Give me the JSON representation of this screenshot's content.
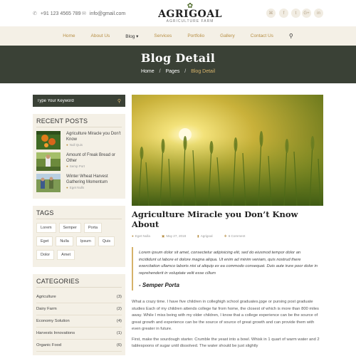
{
  "header": {
    "phone_icon": "phone-icon",
    "phone": "+91 123 4565 789",
    "email_icon": "mail-icon",
    "email": "info@gmail.com",
    "logo_name": "AGRIGOAL",
    "logo_sub": "AGRICULTURE FARM",
    "social": [
      {
        "icon": "rss-icon",
        "glyph": "⌘"
      },
      {
        "icon": "facebook-icon",
        "glyph": "f"
      },
      {
        "icon": "twitter-icon",
        "glyph": "t"
      },
      {
        "icon": "google-plus-icon",
        "glyph": "G+"
      },
      {
        "icon": "linkedin-icon",
        "glyph": "in"
      }
    ]
  },
  "nav": {
    "items": [
      "Home",
      "About Us",
      "Blog ▾",
      "Services",
      "Portfolio",
      "Gallery",
      "Contact Us"
    ],
    "active_index": 2,
    "search_icon": "search-icon"
  },
  "hero": {
    "title": "Blog Detail",
    "breadcrumb": [
      "Home",
      "Pages",
      "Blog Detail"
    ],
    "separator": "/"
  },
  "sidebar": {
    "search_placeholder": "Type Your Keyword",
    "recent_title": "RECENT POSTS",
    "recent_posts": [
      {
        "title": "Agriculture Miracle you Don't Know",
        "author": "Null Quis"
      },
      {
        "title": "Amount of Freak Bread or Other",
        "author": "Semp Port"
      },
      {
        "title": "Winter Wheat Harvest Gathering Momentum",
        "author": "Eget Nulls"
      }
    ],
    "tags_title": "TAGS",
    "tags": [
      "Lorem",
      "Semper",
      "Porta",
      "Eget",
      "Nulla",
      "Ipsum",
      "Quis",
      "Dolor",
      "Amet"
    ],
    "categories_title": "CATEGORIES",
    "categories": [
      {
        "name": "Agriculture",
        "count": "(3)"
      },
      {
        "name": "Dairy Farm",
        "count": "(2)"
      },
      {
        "name": "Economy Solution",
        "count": "(4)"
      },
      {
        "name": "Harvests Innovations",
        "count": "(1)"
      },
      {
        "name": "Organic Food",
        "count": "(6)"
      }
    ]
  },
  "article": {
    "title": "Agriculture Miracle you Don’t Know About",
    "meta": {
      "author": "Eget Nulla",
      "date": "May 27, 2018",
      "category": "Agrigoal",
      "comments": "6 Comment"
    },
    "quote": "Lorem ipsum dolor sit amet, consectetur adipisicing elit, sed do eiusmod tempor dolor an incididunt ut labore et dolore magna aliqua. Ut enim ad minim veniam, quis nostrud there exercitation ullamco laboris nisi ut aliquip ex ea commodo consequat. Duis aute irure poor dolor in reprehenderit in voluptate velit esse cillum",
    "quote_by": "- Semper Porta",
    "para1": "What a crazy time. I have five children in colleghigh school graduates.jpge or pursing post graduate studies Each of my children attends college far from home, the closest of which is more than 800 miles away. While I miss being with my older children, I know that a college experience can be the source of great growth and experience can be the source of source of great growth and can provide them with even greater in future.",
    "para2": "First, make the sourdough starter. Crumble the yeast into a bowl. Whisk in 1 quart of warm water and 2 tablespoons of sugar until dissolved. The water should be just slightly"
  },
  "colors": {
    "accent": "#b78f45",
    "dark": "#3a4136",
    "cream": "#f4f0e6",
    "gold": "#d6b26a"
  }
}
